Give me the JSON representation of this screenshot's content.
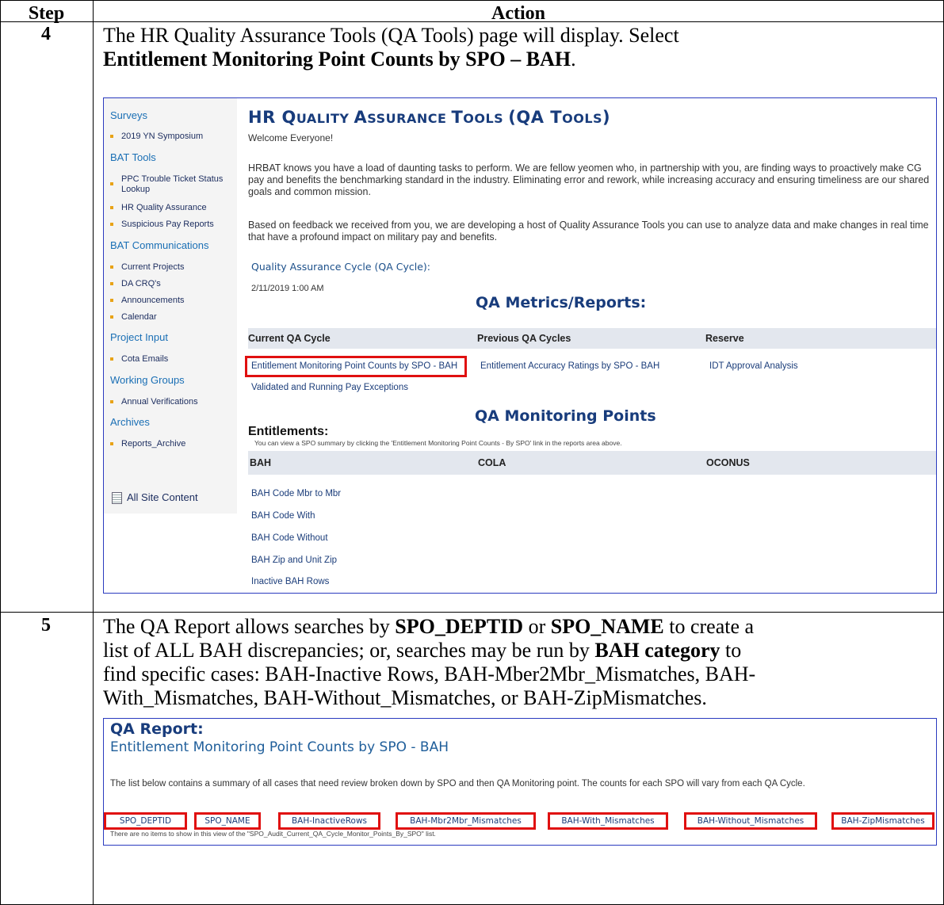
{
  "header": {
    "step_label": "Step",
    "action_label": "Action"
  },
  "step4": {
    "number": "4",
    "text_line1": "The HR Quality Assurance Tools (QA Tools) page will display.  Select",
    "text_bold": "Entitlement Monitoring Point Counts by SPO – BAH",
    "text_end": "."
  },
  "shot1": {
    "nav": {
      "groups": [
        "Surveys",
        "BAT Tools",
        "BAT Communications",
        "Project Input",
        "Working Groups",
        "Archives"
      ],
      "items": {
        "surveys": [
          "2019 YN Symposium"
        ],
        "bat_tools": [
          "PPC Trouble Ticket Status Lookup",
          "HR Quality Assurance",
          "Suspicious Pay Reports"
        ],
        "bat_comms": [
          "Current Projects",
          "DA CRQ's",
          "Announcements",
          "Calendar"
        ],
        "project_input": [
          "Cota Emails"
        ],
        "working_groups": [
          "Annual Verifications"
        ],
        "archives": [
          "Reports_Archive"
        ]
      },
      "all_site_content": "All Site Content"
    },
    "title": "HR Quality Assurance Tools (QA Tools)",
    "welcome": "Welcome Everyone!",
    "para1": "HRBAT knows you have a load of daunting tasks to perform.  We are fellow yeomen who, in partnership with you, are finding ways to proactively make CG pay and benefits the benchmarking standard in the industry.  Eliminating error and rework, while increasing accuracy and ensuring timeliness are our shared goals and common mission.",
    "para2": "Based on feedback we received from you, we are developing a host of Quality Assurance Tools you can use to analyze data and make changes in real time that have a profound impact on military pay and benefits.",
    "cycle_label": "Quality Assurance Cycle (QA Cycle):",
    "cycle_date": "2/11/2019 1:00 AM",
    "metrics_heading": "QA Metrics/Reports:",
    "metrics_cols": [
      "Current QA Cycle",
      "Previous QA Cycles",
      "Reserve"
    ],
    "metrics_links": {
      "current1": "Entitlement Monitoring Point Counts by SPO - BAH",
      "current2": "Validated and Running Pay Exceptions",
      "previous1": "Entitlement Accuracy Ratings by SPO - BAH",
      "reserve1": "IDT Approval Analysis"
    },
    "monitoring_heading": "QA Monitoring Points",
    "entitlements_heading": "Entitlements:",
    "entitlements_note": "You can view a SPO summary by clicking the 'Entitlement Monitoring Point Counts - By SPO' link in the reports area above.",
    "ent_cols": [
      "BAH",
      "COLA",
      "OCONUS"
    ],
    "bah_links": [
      "BAH Code Mbr to Mbr",
      "BAH Code With",
      "BAH Code Without",
      "BAH Zip and Unit Zip",
      "Inactive BAH Rows"
    ]
  },
  "step5": {
    "number": "5",
    "l1a": "The QA Report allows searches by ",
    "l1b": "SPO_DEPTID",
    "l1c": " or ",
    "l1d": "SPO_NAME",
    "l1e": " to create a",
    "l2a": "list of ALL BAH discrepancies; or, searches may be run by ",
    "l2b": "BAH category",
    "l2c": " to",
    "l3": "find specific cases:  BAH-Inactive Rows, BAH-Mber2Mbr_Mismatches, BAH-",
    "l4": "With_Mismatches, BAH-Without_Mismatches, or BAH-ZipMismatches."
  },
  "shot2": {
    "title": "QA Report:",
    "subtitle": "Entitlement Monitoring Point Counts by SPO - BAH",
    "desc": "The list below contains a summary of all cases that need review broken down by SPO and then QA Monitoring point. The counts for each SPO will vary from each QA Cycle.",
    "buttons": [
      "SPO_DEPTID",
      "SPO_NAME",
      "BAH-InactiveRows",
      "BAH-Mbr2Mbr_Mismatches",
      "BAH-With_Mismatches",
      "BAH-Without_Mismatches",
      "BAH-ZipMismatches"
    ],
    "empty": "There are no items to show in this view of the \"SPO_Audit_Current_QA_Cycle_Monitor_Points_By_SPO\" list."
  }
}
